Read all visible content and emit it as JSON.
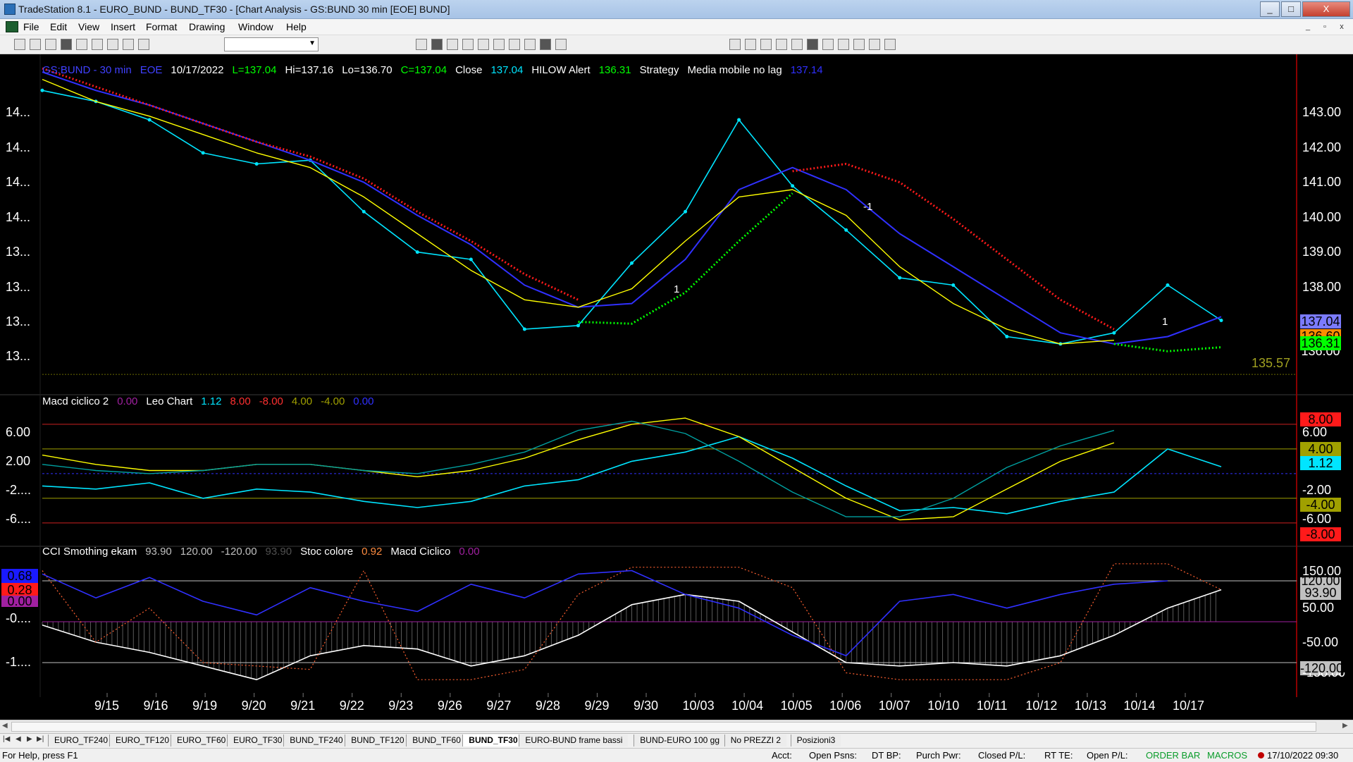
{
  "window": {
    "title": "TradeStation 8.1 - EURO_BUND - BUND_TF30 - [Chart Analysis - GS:BUND  30 min  [EOE] BUND]"
  },
  "window_buttons": [
    "_",
    "□",
    "X"
  ],
  "mdi_buttons": [
    "_",
    "▫",
    "x"
  ],
  "menu": [
    "File",
    "Edit",
    "View",
    "Insert",
    "Format",
    "Drawing",
    "Window",
    "Help"
  ],
  "toolbar_icons": [
    "new-icon",
    "open-icon",
    "save-icon",
    "copy-icon",
    "paste-icon",
    "print-icon",
    "print-preview-icon",
    "lock-icon",
    "clipboard-icon",
    "palette-icon",
    "chart-style-icon",
    "bar-icon",
    "line-icon",
    "table-icon",
    "strategy-icon",
    "indicator-icon",
    "grid-icon",
    "zoom-in-icon",
    "zoom-out-icon",
    "pointer-icon",
    "tool-icon",
    "trendline-icon",
    "fib-icon",
    "horizontal-line-icon",
    "vertical-line-icon",
    "arrow-up-icon",
    "arrow-down-icon",
    "ellipse-icon",
    "rectangle-icon",
    "text-icon"
  ],
  "price_pane": {
    "title": [
      {
        "text": "GS:BUND - 30 min",
        "color": "#4040ff"
      },
      {
        "text": "EOE",
        "color": "#4040ff"
      },
      {
        "text": "10/17/2022",
        "color": "#ffffff"
      },
      {
        "text": "L=137.04",
        "color": "#00ff00"
      },
      {
        "text": "Hi=137.16",
        "color": "#ffffff"
      },
      {
        "text": "Lo=136.70",
        "color": "#ffffff"
      },
      {
        "text": "C=137.04",
        "color": "#00ff00"
      },
      {
        "text": "Close",
        "color": "#ffffff"
      },
      {
        "text": "137.04",
        "color": "#00e5ff"
      },
      {
        "text": "HILOW Alert",
        "color": "#ffffff"
      },
      {
        "text": "136.31",
        "color": "#00ff00"
      },
      {
        "text": "Strategy",
        "color": "#ffffff"
      },
      {
        "text": "Media mobile no lag",
        "color": "#ffffff"
      },
      {
        "text": "137.14",
        "color": "#3030ff"
      }
    ],
    "right_axis": [
      "143.00",
      "142.00",
      "141.00",
      "140.00",
      "139.00",
      "138.00"
    ],
    "left_axis": [
      "14...",
      "14...",
      "14...",
      "14...",
      "13...",
      "13...",
      "13...",
      "13..."
    ],
    "flags": [
      {
        "text": "137.04",
        "bg": "#7b7bff"
      },
      {
        "text": "136.60",
        "bg": "#ff8c00"
      },
      {
        "text": "136.31",
        "bg": "#00ff00"
      },
      {
        "text": "136.00",
        "bg": "#000000"
      }
    ],
    "level_label": "135.57",
    "signal_labels": [
      "1",
      "-1",
      "1"
    ]
  },
  "macd_pane": {
    "title": [
      {
        "text": "Macd ciclico 2",
        "color": "#ffffff"
      },
      {
        "text": "0.00",
        "color": "#a020a0"
      },
      {
        "text": "Leo Chart",
        "color": "#ffffff"
      },
      {
        "text": "1.12",
        "color": "#00e5ff"
      },
      {
        "text": "8.00",
        "color": "#ff3030"
      },
      {
        "text": "-8.00",
        "color": "#ff3030"
      },
      {
        "text": "4.00",
        "color": "#a0a000"
      },
      {
        "text": "-4.00",
        "color": "#a0a000"
      },
      {
        "text": "0.00",
        "color": "#3030ff"
      }
    ],
    "left_axis": [
      "6.00",
      "2.00",
      "-2....",
      "-6...."
    ],
    "right_axis": [
      "6.00",
      "-2.00",
      "-6.00"
    ],
    "flags": [
      {
        "text": "8.00",
        "bg": "#ff1a1a",
        "fg": "#ffffff"
      },
      {
        "text": "4.00",
        "bg": "#a0a000",
        "fg": "#000000"
      },
      {
        "text": "1.12",
        "bg": "#00e5ff",
        "fg": "#000000"
      },
      {
        "text": "-4.00",
        "bg": "#a0a000",
        "fg": "#000000"
      },
      {
        "text": "-8.00",
        "bg": "#ff1a1a",
        "fg": "#ffffff"
      }
    ]
  },
  "cci_pane": {
    "title": [
      {
        "text": "CCI Smothing ekam",
        "color": "#ffffff"
      },
      {
        "text": "93.90",
        "color": "#c0c0c0"
      },
      {
        "text": "120.00",
        "color": "#c0c0c0"
      },
      {
        "text": "-120.00",
        "color": "#c0c0c0"
      },
      {
        "text": "93.90",
        "color": "#505050"
      },
      {
        "text": "Stoc colore",
        "color": "#ffffff"
      },
      {
        "text": "0.92",
        "color": "#ff8c40"
      },
      {
        "text": "Macd Ciclico",
        "color": "#ffffff"
      },
      {
        "text": "0.00",
        "color": "#a020a0"
      }
    ],
    "left_axis": [
      "-0....",
      "-1...."
    ],
    "left_flags": [
      {
        "text": "0.68",
        "bg": "#1a1aff"
      },
      {
        "text": "0.28",
        "bg": "#ff1a1a"
      },
      {
        "text": "0.00",
        "bg": "#a020a0"
      }
    ],
    "right_axis": [
      "150.00",
      "50.00",
      "-50.00",
      "-150.00"
    ],
    "flags": [
      {
        "text": "120.00",
        "bg": "#c0c0c0"
      },
      {
        "text": "93.90",
        "bg": "#c0c0c0"
      },
      {
        "text": "-120.00",
        "bg": "#c0c0c0"
      }
    ]
  },
  "dates": [
    "9/15",
    "9/16",
    "9/19",
    "9/20",
    "9/21",
    "9/22",
    "9/23",
    "9/26",
    "9/27",
    "9/28",
    "9/29",
    "9/30",
    "10/03",
    "10/04",
    "10/05",
    "10/06",
    "10/07",
    "10/10",
    "10/11",
    "10/12",
    "10/13",
    "10/14",
    "10/17"
  ],
  "tabs": [
    "EURO_TF240",
    "EURO_TF120",
    "EURO_TF60",
    "EURO_TF30",
    "BUND_TF240",
    "BUND_TF120",
    "BUND_TF60",
    "BUND_TF30",
    "EURO-BUND frame bassi",
    "BUND-EURO 100 gg",
    "No PREZZI 2",
    "Posizioni3"
  ],
  "active_tab": "BUND_TF30",
  "status": {
    "help": "For Help, press F1",
    "fields": [
      "Acct:",
      "Open Psns:",
      "DT BP:",
      "Purch Pwr:",
      "Closed P/L:",
      "RT TE:",
      "Open P/L:"
    ],
    "order_bar": "ORDER BAR",
    "macros": "MACROS",
    "datetime": "17/10/2022 09:30"
  },
  "chart_data": [
    {
      "type": "line",
      "title": "GS:BUND - 30 min",
      "x": [
        "9/15",
        "9/16",
        "9/19",
        "9/20",
        "9/21",
        "9/22",
        "9/23",
        "9/26",
        "9/27",
        "9/28",
        "9/29",
        "9/30",
        "10/03",
        "10/04",
        "10/05",
        "10/06",
        "10/07",
        "10/10",
        "10/11",
        "10/12",
        "10/13",
        "10/14",
        "10/17"
      ],
      "series": [
        {
          "name": "Close",
          "color": "#00e5ff",
          "values": [
            143.3,
            143.0,
            142.5,
            141.6,
            141.3,
            141.4,
            140.0,
            138.9,
            138.7,
            136.8,
            136.9,
            138.6,
            140.0,
            142.5,
            140.7,
            139.5,
            138.2,
            138.0,
            136.6,
            136.4,
            136.7,
            138.0,
            137.04
          ]
        },
        {
          "name": "Media mobile no lag",
          "color": "#3030ff",
          "values": [
            143.8,
            143.3,
            142.9,
            142.4,
            141.9,
            141.4,
            140.8,
            139.9,
            139.1,
            138.0,
            137.4,
            137.5,
            138.7,
            140.6,
            141.2,
            140.6,
            139.4,
            138.5,
            137.6,
            136.7,
            136.4,
            136.6,
            137.14
          ]
        },
        {
          "name": "HILOW Alert",
          "color": "#00ff00",
          "values": [
            null,
            null,
            null,
            null,
            null,
            141.4,
            null,
            null,
            null,
            null,
            137.0,
            136.95,
            137.8,
            139.2,
            140.5,
            null,
            null,
            null,
            null,
            null,
            136.4,
            136.2,
            136.31
          ]
        },
        {
          "name": "HILOW Alert (red)",
          "color": "#ff1a1a",
          "values": [
            143.9,
            143.4,
            142.9,
            142.4,
            141.9,
            141.5,
            140.9,
            140.0,
            139.2,
            138.3,
            137.6,
            null,
            null,
            null,
            141.1,
            141.3,
            140.8,
            139.8,
            138.7,
            137.6,
            136.8,
            null,
            136.6
          ]
        },
        {
          "name": "Yellow average",
          "color": "#ffff00",
          "values": [
            143.6,
            143.0,
            142.6,
            142.1,
            141.6,
            141.2,
            140.4,
            139.4,
            138.4,
            137.6,
            137.4,
            137.9,
            139.2,
            140.4,
            140.6,
            139.9,
            138.5,
            137.5,
            136.8,
            136.4,
            136.5,
            null,
            null
          ]
        }
      ],
      "ylim": [
        135.4,
        143.9
      ],
      "level": 135.57
    },
    {
      "type": "line",
      "title": "Macd ciclico 2",
      "x": [
        "9/15",
        "9/16",
        "9/19",
        "9/20",
        "9/21",
        "9/22",
        "9/23",
        "9/26",
        "9/27",
        "9/28",
        "9/29",
        "9/30",
        "10/03",
        "10/04",
        "10/05",
        "10/06",
        "10/07",
        "10/10",
        "10/11",
        "10/12",
        "10/13",
        "10/14",
        "10/17"
      ],
      "series": [
        {
          "name": "Leo Chart",
          "color": "#00e5ff",
          "values": [
            -2.0,
            -2.5,
            -1.5,
            -4.0,
            -2.5,
            -3.0,
            -4.5,
            -5.5,
            -4.5,
            -2.0,
            -1.0,
            2.0,
            3.5,
            6.0,
            2.5,
            -2.0,
            -6.0,
            -5.5,
            -6.5,
            -4.5,
            -3.0,
            4.0,
            1.12
          ]
        },
        {
          "name": "Yellow cycle",
          "color": "#ffff00",
          "values": [
            3.0,
            1.5,
            0.5,
            0.5,
            1.5,
            1.5,
            0.5,
            -0.5,
            0.5,
            2.5,
            5.5,
            8.0,
            9.0,
            6.0,
            1.0,
            -4.0,
            -7.5,
            -7.0,
            -2.5,
            2.0,
            5.0,
            null,
            null
          ]
        },
        {
          "name": "Teal cycle",
          "color": "#00a0a0",
          "values": [
            1.5,
            0.5,
            0.0,
            0.5,
            1.5,
            1.5,
            0.5,
            0.0,
            1.5,
            3.5,
            7.0,
            8.5,
            6.5,
            2.0,
            -3.0,
            -7.0,
            -7.0,
            -4.0,
            1.0,
            4.5,
            7.0,
            null,
            null
          ]
        }
      ],
      "levels": [
        8.0,
        4.0,
        0.0,
        -4.0,
        -8.0
      ],
      "ylim": [
        -9.5,
        10.5
      ]
    },
    {
      "type": "line",
      "title": "CCI Smothing ekam",
      "x": [
        "9/15",
        "9/16",
        "9/19",
        "9/20",
        "9/21",
        "9/22",
        "9/23",
        "9/26",
        "9/27",
        "9/28",
        "9/29",
        "9/30",
        "10/03",
        "10/04",
        "10/05",
        "10/06",
        "10/07",
        "10/10",
        "10/11",
        "10/12",
        "10/13",
        "10/14",
        "10/17"
      ],
      "series": [
        {
          "name": "CCI Smothing ekam",
          "color": "#ffffff",
          "values": [
            -10,
            -60,
            -90,
            -130,
            -170,
            -100,
            -70,
            -80,
            -130,
            -100,
            -40,
            50,
            80,
            60,
            -30,
            -120,
            -130,
            -120,
            -130,
            -100,
            -40,
            40,
            93.9
          ]
        },
        {
          "name": "Stoc colore",
          "color": "#ff6030",
          "values": [
            150,
            -60,
            40,
            -120,
            -130,
            -140,
            150,
            -170,
            -170,
            -140,
            80,
            160,
            160,
            160,
            100,
            -150,
            -170,
            -170,
            -170,
            -120,
            170,
            170,
            93.9
          ]
        },
        {
          "name": "Macd Ciclico",
          "color": "#3030ff",
          "values": [
            140,
            70,
            130,
            60,
            20,
            100,
            60,
            30,
            110,
            70,
            140,
            150,
            80,
            40,
            -40,
            -100,
            60,
            80,
            40,
            80,
            110,
            120,
            null
          ]
        }
      ],
      "levels": [
        120,
        0,
        -120
      ],
      "ylim": [
        -180,
        180
      ]
    }
  ]
}
